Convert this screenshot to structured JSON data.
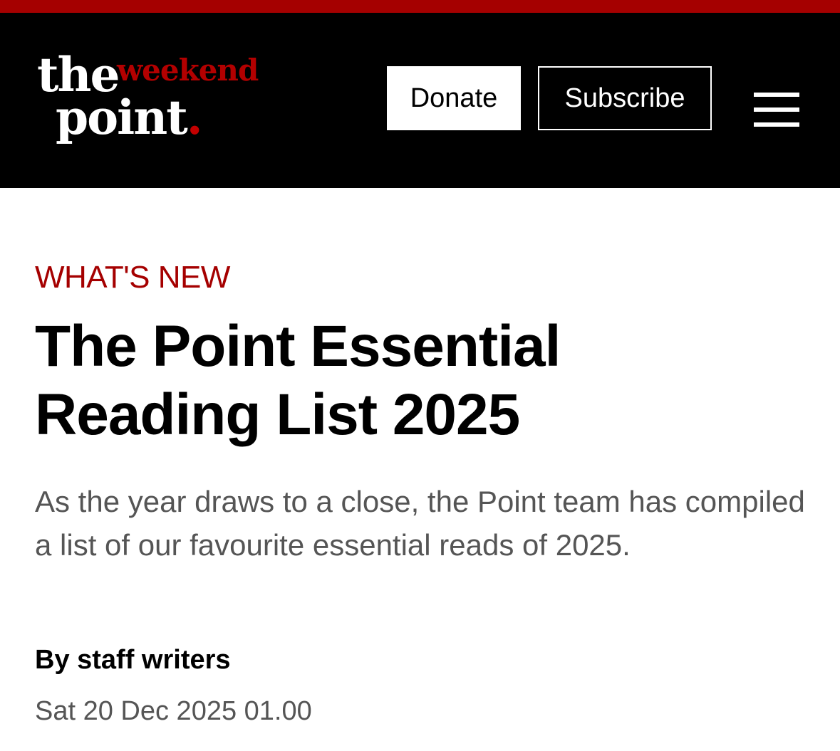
{
  "header": {
    "logo": {
      "the": "the",
      "weekend": "weekend",
      "point": "point",
      "dot": "."
    },
    "donate_label": "Donate",
    "subscribe_label": "Subscribe",
    "menu_icon": "hamburger-menu-icon"
  },
  "article": {
    "category": "WHAT'S NEW",
    "title": "The Point Essential Reading List 2025",
    "standfirst": "As the year draws to a close, the Point team has compiled a list of our favourite essential reads of 2025.",
    "byline": "By staff writers",
    "date": "Sat 20 Dec 2025 01.00"
  },
  "colors": {
    "accent": "#a50000",
    "header_bg": "#000000",
    "text": "#000000",
    "muted_text": "#555555"
  }
}
